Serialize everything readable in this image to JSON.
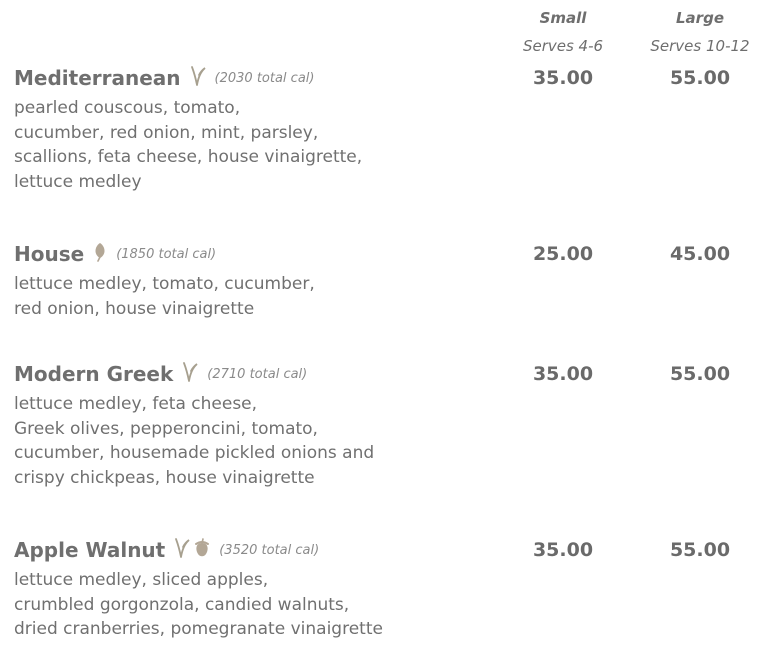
{
  "header": {
    "small_label": "Small",
    "small_serves": "Serves 4-6",
    "large_label": "Large",
    "large_serves": "Serves 10-12"
  },
  "colors": {
    "text": "#6e6e6e",
    "vegetarian_icon": "#a7a08f",
    "vegan_icon": "#b3a796",
    "nut_icon": "#b3a796"
  },
  "items": [
    {
      "name": "Mediterranean",
      "icons": [
        "vegetarian-sprout-icon"
      ],
      "calories": "(2030 total cal)",
      "desc_lines": [
        "pearled couscous, tomato,",
        "cucumber, red onion, mint, parsley,",
        "scallions, feta cheese, house vinaigrette,",
        "lettuce medley"
      ],
      "price_small": "35.00",
      "price_large": "55.00"
    },
    {
      "name": "House",
      "icons": [
        "vegan-leaf-icon"
      ],
      "calories": "(1850 total cal)",
      "desc_lines": [
        "lettuce medley, tomato, cucumber,",
        "red onion, house vinaigrette"
      ],
      "price_small": "25.00",
      "price_large": "45.00"
    },
    {
      "name": "Modern Greek",
      "icons": [
        "vegetarian-sprout-icon"
      ],
      "calories": "(2710 total cal)",
      "desc_lines": [
        "lettuce medley, feta cheese,",
        "Greek olives, pepperoncini, tomato,",
        "cucumber, housemade pickled onions and",
        "crispy chickpeas, house vinaigrette"
      ],
      "price_small": "35.00",
      "price_large": "55.00"
    },
    {
      "name": "Apple Walnut",
      "icons": [
        "vegetarian-sprout-icon",
        "nut-icon"
      ],
      "calories": "(3520 total cal)",
      "desc_lines": [
        "lettuce medley, sliced apples,",
        "crumbled gorgonzola, candied walnuts,",
        "dried cranberries, pomegranate vinaigrette"
      ],
      "price_small": "35.00",
      "price_large": "55.00"
    }
  ]
}
